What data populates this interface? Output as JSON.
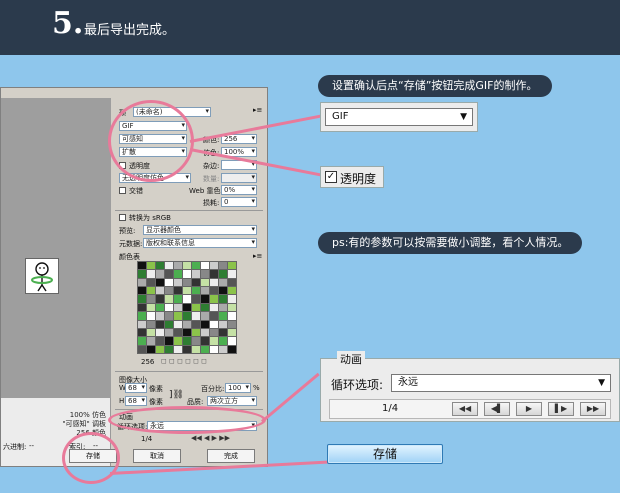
{
  "header": {
    "step_number": "5.",
    "step_text": "最后导出完成。"
  },
  "dialog": {
    "preset_label": "预",
    "preset_value": "(未命名)",
    "format_value": "GIF",
    "reduction_value": "可感知",
    "dither_method_value": "扩散",
    "colors_label": "颜色:",
    "colors_value": "256",
    "dither_label": "仿色:",
    "dither_value": "100%",
    "transparency_label": "透明度",
    "matte_label": "杂边:",
    "transparency_dither_value": "无透明度仿色",
    "amount_label": "数量:",
    "interlaced_label": "交错",
    "web_snap_label": "Web 靠色:",
    "web_snap_value": "0%",
    "lossy_label": "损耗:",
    "lossy_value": "0",
    "convert_srgb_label": "转换为 sRGB",
    "preview_label": "预览:",
    "preview_value": "显示器颜色",
    "metadata_label": "元数据:",
    "metadata_value": "版权和联系信息",
    "color_table_label": "颜色表",
    "color_table_count": "256",
    "image_size_label": "图像大小",
    "width_label": "W",
    "width_value": "68",
    "height_label": "H",
    "height_value": "68",
    "pixels_label": "像素",
    "percent_label": "百分比:",
    "percent_value": "100",
    "percent_unit": "%",
    "quality_label": "品质:",
    "quality_value": "两次立方",
    "animation_label": "动画",
    "loop_label": "循环选项:",
    "loop_value": "永远",
    "frame_counter": "1/4",
    "save_button": "存储",
    "cancel_button": "取消",
    "done_button": "完成",
    "preview_info_1": "100% 仿色",
    "preview_info_2": "\"可感知\" 调板",
    "preview_info_3": "256 颜色",
    "status_left": "六进制:",
    "status_left_value": "--",
    "status_index": "索引:",
    "status_index_value": "--"
  },
  "callouts": {
    "save_note": "设置确认后点“存储”按钮完成GIF的制作。",
    "params_note": "ps:有的参数可以按需要做小调整，看个人情况。"
  },
  "zoom": {
    "format_value": "GIF",
    "transparency_label": "透明度",
    "animation_title": "动画",
    "loop_label": "循环选项:",
    "loop_value": "永远",
    "frame_counter": "1/4",
    "save_button": "存储"
  },
  "colors": {
    "banner": "#2b3a4c",
    "background": "#8ec6ec",
    "highlight": "#e87a9a",
    "dialog": "#d4d0c8"
  },
  "icons": {
    "dropdown": "chevron-down-icon",
    "first_frame": "first-frame-icon",
    "prev_frame": "prev-frame-icon",
    "play": "play-icon",
    "next_frame": "next-frame-icon",
    "last_frame": "last-frame-icon"
  }
}
